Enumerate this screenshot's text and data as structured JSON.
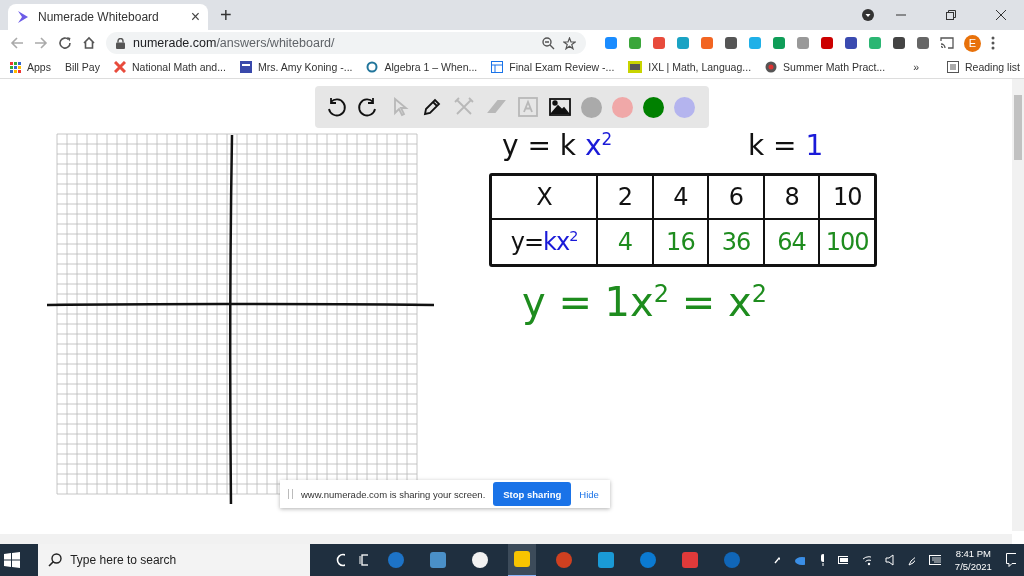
{
  "browser": {
    "tab_title": "Numerade Whiteboard",
    "new_tab": "+",
    "close_glyph": "×",
    "url_host": "numerade.com",
    "url_path": "/answers/whiteboard/",
    "profile_initial": "E",
    "bookmarks": [
      {
        "label": "Apps",
        "kind": "apps"
      },
      {
        "label": "Bill Pay",
        "kind": "none"
      },
      {
        "label": "National Math and...",
        "kind": "star"
      },
      {
        "label": "Mrs. Amy Koning -...",
        "kind": "page"
      },
      {
        "label": "Algebra 1 – When...",
        "kind": "wp"
      },
      {
        "label": "Final Exam Review -...",
        "kind": "form"
      },
      {
        "label": "IXL | Math, Languag...",
        "kind": "ixl"
      },
      {
        "label": "Summer Math Pract...",
        "kind": "circle"
      }
    ],
    "bookmarks_overflow": "»",
    "reading_list": "Reading list"
  },
  "toolbar": {
    "tools": [
      {
        "kind": "undo",
        "enabled": true
      },
      {
        "kind": "redo",
        "enabled": true
      },
      {
        "kind": "select",
        "enabled": false
      },
      {
        "kind": "pen",
        "enabled": true
      },
      {
        "kind": "tools",
        "enabled": false
      },
      {
        "kind": "eraser",
        "enabled": false
      },
      {
        "kind": "text",
        "enabled": false
      },
      {
        "kind": "image",
        "enabled": true
      }
    ],
    "colors": [
      {
        "color": "#aaaaaa"
      },
      {
        "color": "#f0a8a8"
      },
      {
        "color": "#008000"
      },
      {
        "color": "#b4b4ee"
      }
    ]
  },
  "board": {
    "formula": [
      {
        "text": "y = k ",
        "color": "#111111"
      },
      {
        "text": "x$^{2}$",
        "color": "#1a1ad8"
      }
    ],
    "constant": [
      {
        "text": "k = ",
        "color": "#111111"
      },
      {
        "text": "1",
        "color": "#1a1ad8"
      }
    ],
    "table": [
      [
        [
          {
            "text": "X",
            "color": "#111111"
          }
        ],
        [
          {
            "text": "2",
            "color": "#111111"
          }
        ],
        [
          {
            "text": "4",
            "color": "#111111"
          }
        ],
        [
          {
            "text": "6",
            "color": "#111111"
          }
        ],
        [
          {
            "text": "8",
            "color": "#111111"
          }
        ],
        [
          {
            "text": "10",
            "color": "#111111"
          }
        ]
      ],
      [
        [
          {
            "text": "y=",
            "color": "#111111"
          },
          {
            "text": "kx$^{2}$",
            "color": "#1a1ad8"
          }
        ],
        [
          {
            "text": "4",
            "color": "#1e8c1e"
          }
        ],
        [
          {
            "text": "16",
            "color": "#1e8c1e"
          }
        ],
        [
          {
            "text": "36",
            "color": "#1e8c1e"
          }
        ],
        [
          {
            "text": "64",
            "color": "#1e8c1e"
          }
        ],
        [
          {
            "text": "100",
            "color": "#1e8c1e"
          }
        ]
      ]
    ],
    "equation": [
      {
        "text": "y = 1x$^{2}$ = x$^{2}$",
        "color": "#1e8c1e"
      }
    ]
  },
  "share_bar": {
    "message": "www.numerade.com is sharing your screen.",
    "stop_button": "Stop sharing",
    "hide_link": "Hide"
  },
  "taskbar": {
    "search_placeholder": "Type here to search",
    "time": "8:41 PM",
    "date": "7/5/2021"
  }
}
